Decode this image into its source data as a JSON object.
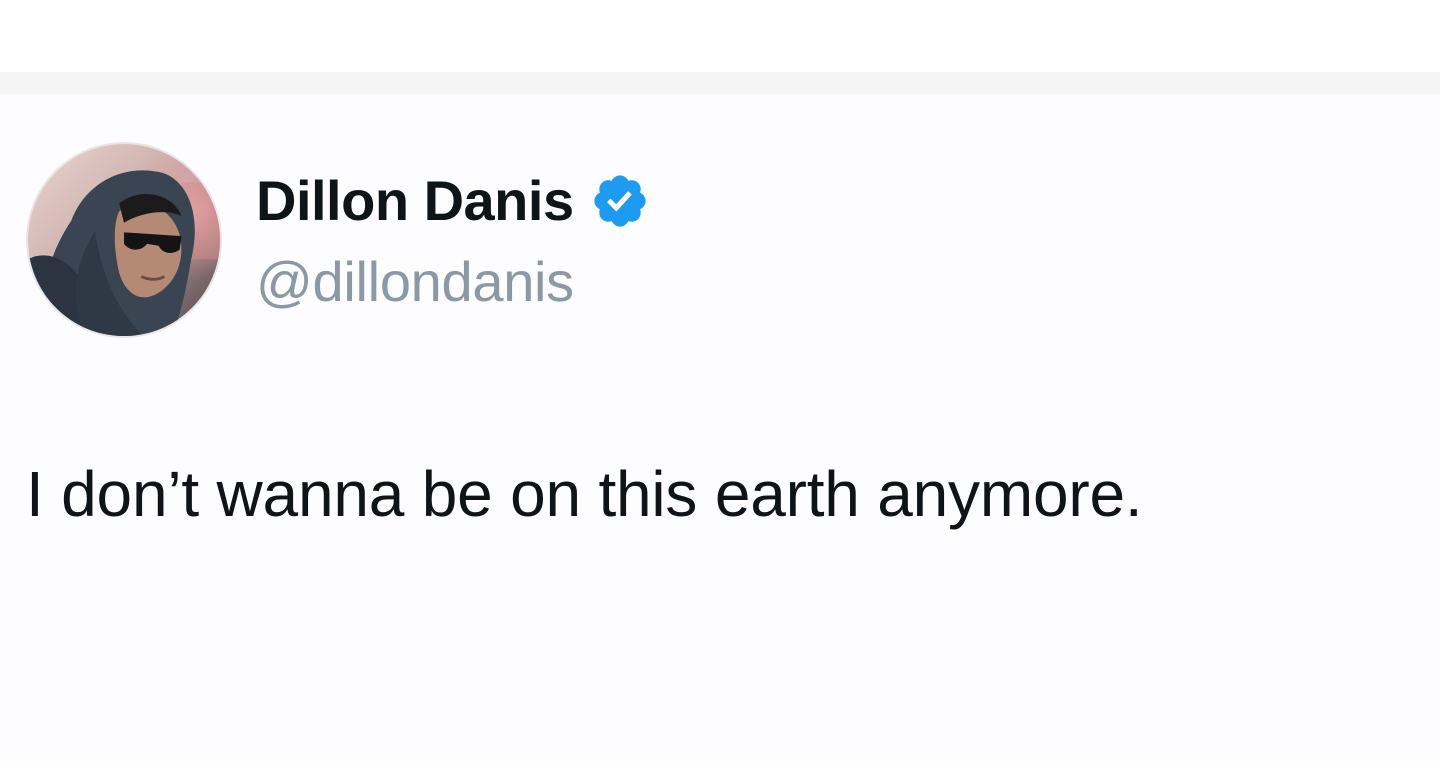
{
  "tweet": {
    "author": {
      "display_name": "Dillon Danis",
      "handle": "@dillondanis",
      "verified": true,
      "verified_badge_color": "#1d9bf0",
      "avatar_icon": "avatar-photo"
    },
    "text": "I don’t wanna be on this earth anymore."
  },
  "colors": {
    "name": "#0f1419",
    "handle": "#8b98a5",
    "background": "#fdfcfe"
  }
}
